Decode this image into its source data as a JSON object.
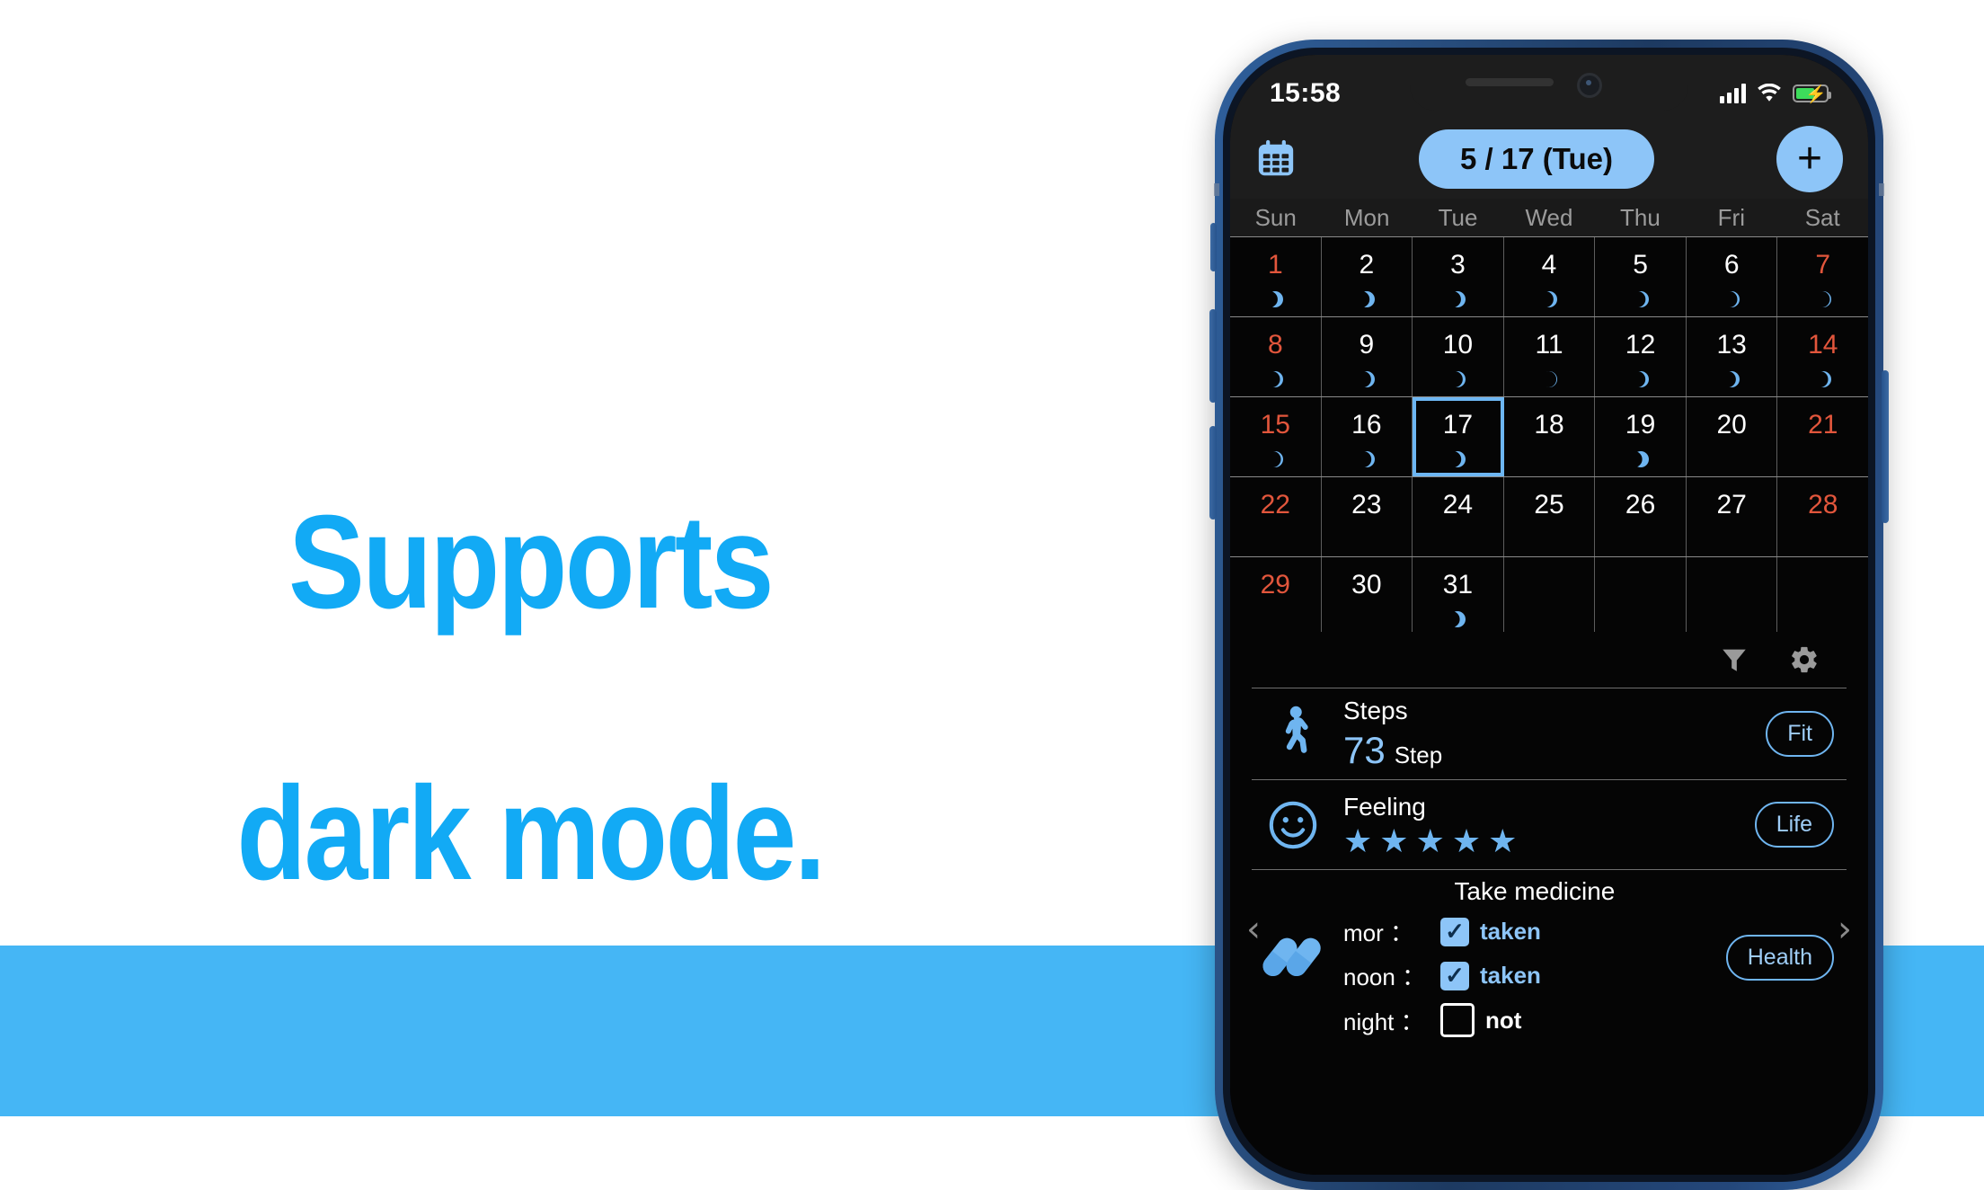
{
  "marketing": {
    "headline_line1": "Supports",
    "headline_line2": "dark mode.",
    "headline_color": "#12aaf5",
    "band_color": "#45b6f5"
  },
  "phone": {
    "frame_color": "#2b5386",
    "status_bar": {
      "time": "15:58",
      "signal_icon": "signal-bars-icon",
      "wifi_icon": "wifi-icon",
      "battery_icon": "battery-charging-icon",
      "battery_color": "#3ddc5b"
    }
  },
  "app": {
    "header": {
      "calendar_icon": "calendar-icon",
      "date_pill": "5 / 17 (Tue)",
      "add_label": "+",
      "accent": "#8dc5f8"
    },
    "weekdays": [
      "Sun",
      "Mon",
      "Tue",
      "Wed",
      "Thu",
      "Fri",
      "Sat"
    ],
    "calendar": {
      "selected_day": "17",
      "weekend_color": "#e2563c",
      "rows": [
        [
          {
            "day": "1",
            "moon": 0.18
          },
          {
            "day": "2",
            "moon": 0.2
          },
          {
            "day": "3",
            "moon": 0.24
          },
          {
            "day": "4",
            "moon": 0.3
          },
          {
            "day": "5",
            "moon": 0.33
          },
          {
            "day": "6",
            "moon": 0.4
          },
          {
            "day": "7",
            "moon": 0.46
          }
        ],
        [
          {
            "day": "8",
            "moon": 0.34
          },
          {
            "day": "9",
            "moon": 0.3
          },
          {
            "day": "10",
            "moon": 0.36
          },
          {
            "day": "11",
            "moon": 0.5
          },
          {
            "day": "12",
            "moon": 0.32
          },
          {
            "day": "13",
            "moon": 0.3
          },
          {
            "day": "14",
            "moon": 0.34
          }
        ],
        [
          {
            "day": "15",
            "moon": 0.4
          },
          {
            "day": "16",
            "moon": 0.32
          },
          {
            "day": "17",
            "moon": 0.26
          },
          {
            "day": "18",
            "moon": null
          },
          {
            "day": "19",
            "moon": 0.1
          },
          {
            "day": "20",
            "moon": null
          },
          {
            "day": "21",
            "moon": null
          }
        ],
        [
          {
            "day": "22",
            "moon": null
          },
          {
            "day": "23",
            "moon": null
          },
          {
            "day": "24",
            "moon": null
          },
          {
            "day": "25",
            "moon": null
          },
          {
            "day": "26",
            "moon": null
          },
          {
            "day": "27",
            "moon": null
          },
          {
            "day": "28",
            "moon": null
          }
        ],
        [
          {
            "day": "29",
            "moon": null
          },
          {
            "day": "30",
            "moon": null
          },
          {
            "day": "31",
            "moon": 0.16
          },
          {
            "day": "",
            "moon": null
          },
          {
            "day": "",
            "moon": null
          },
          {
            "day": "",
            "moon": null
          },
          {
            "day": "",
            "moon": null
          }
        ]
      ]
    },
    "toolbar": {
      "filter_icon": "filter-icon",
      "settings_icon": "gear-icon"
    },
    "cards": {
      "steps": {
        "icon": "walking-person-icon",
        "title": "Steps",
        "value": "73",
        "unit": "Step",
        "tag": "Fit"
      },
      "feeling": {
        "icon": "smiley-face-icon",
        "title": "Feeling",
        "stars_filled": 5,
        "star_glyph": "★",
        "tag": "Life"
      },
      "medicine": {
        "icon": "pills-icon",
        "title": "Take medicine",
        "prev_icon": "chevron-left-icon",
        "next_icon": "chevron-right-icon",
        "tag": "Health",
        "rows": [
          {
            "label": "mor",
            "colon": "：",
            "checked": true,
            "state": "taken"
          },
          {
            "label": "noon",
            "colon": "：",
            "checked": true,
            "state": "taken"
          },
          {
            "label": "night",
            "colon": "：",
            "checked": false,
            "state": "not"
          }
        ]
      }
    }
  }
}
